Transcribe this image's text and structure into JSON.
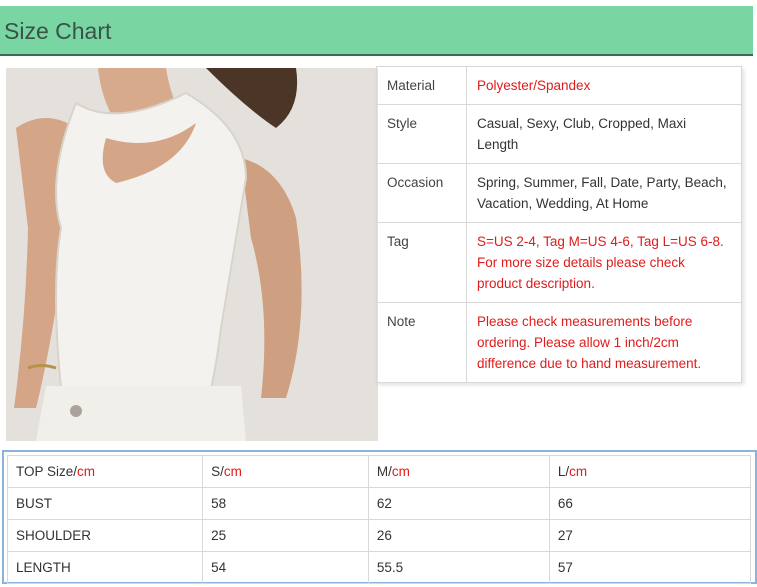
{
  "header": {
    "title": "Size Chart"
  },
  "photo": {
    "alt_icon": "product-photo-white-tank-top"
  },
  "info": {
    "rows": [
      {
        "key": "Material",
        "value": "Polyester/Spandex",
        "highlight": true
      },
      {
        "key": "Style",
        "value": "Casual, Sexy, Club, Cropped, Maxi Length",
        "highlight": false
      },
      {
        "key": "Occasion",
        "value": "Spring, Summer, Fall, Date, Party, Beach, Vacation, Wedding, At Home",
        "highlight": false
      },
      {
        "key": "Tag",
        "value": "S=US 2-4, Tag M=US 4-6, Tag L=US 6-8. For more size details please check product description.",
        "highlight": true
      },
      {
        "key": "Note",
        "value": "Please check measurements before ordering. Please allow 1 inch/2cm difference due to hand measurement.",
        "highlight": true
      }
    ]
  },
  "sizes": {
    "unit": "cm",
    "headers": [
      {
        "label": "TOP Size/"
      },
      {
        "label": "S/"
      },
      {
        "label": "M/"
      },
      {
        "label": "L/"
      }
    ],
    "rows": [
      [
        "BUST",
        "58",
        "62",
        "66"
      ],
      [
        "SHOULDER",
        "25",
        "26",
        "27"
      ],
      [
        "LENGTH",
        "54",
        "55.5",
        "57"
      ]
    ]
  },
  "colors": {
    "header_bg": "#79d5a2",
    "accent_red": "#e01b1b",
    "table_frame": "#8db3dd"
  }
}
